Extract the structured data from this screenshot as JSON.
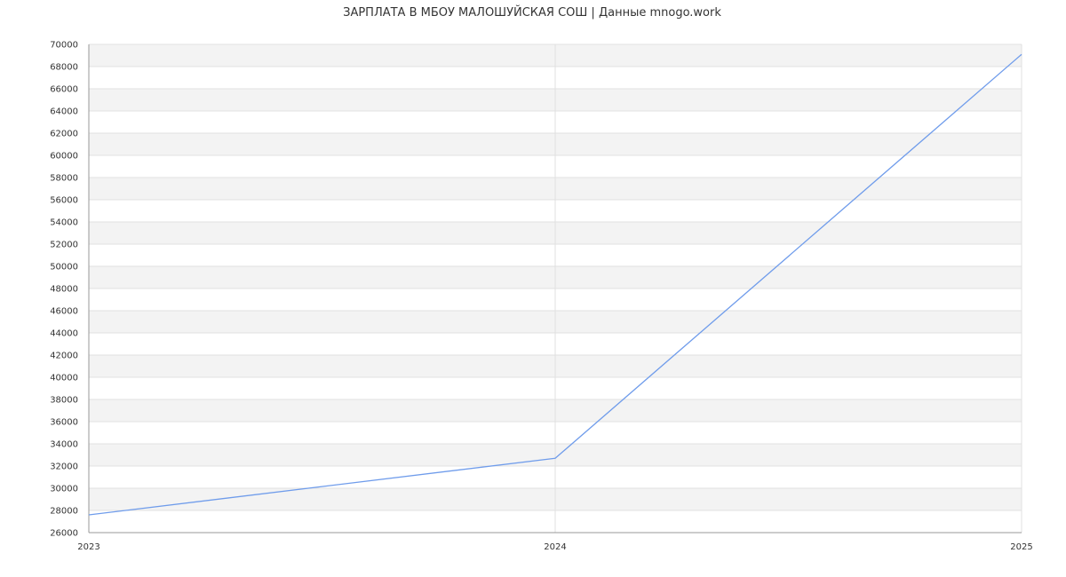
{
  "chart_data": {
    "type": "line",
    "title": "ЗАРПЛАТА В МБОУ МАЛОШУЙСКАЯ СОШ | Данные mnogo.work",
    "xlabel": "",
    "ylabel": "",
    "x": [
      "2023",
      "2024",
      "2025"
    ],
    "series": [
      {
        "values": [
          27600,
          32700,
          69100
        ]
      }
    ],
    "ylim": [
      26000,
      70000
    ],
    "y_tick_step": 2000,
    "grid": true,
    "alternating_bands": true,
    "legend": "none",
    "colors": {
      "line": "#6f9ceb",
      "band": "#f3f3f3",
      "grid": "#e0e0e0",
      "axis": "#999999"
    }
  }
}
